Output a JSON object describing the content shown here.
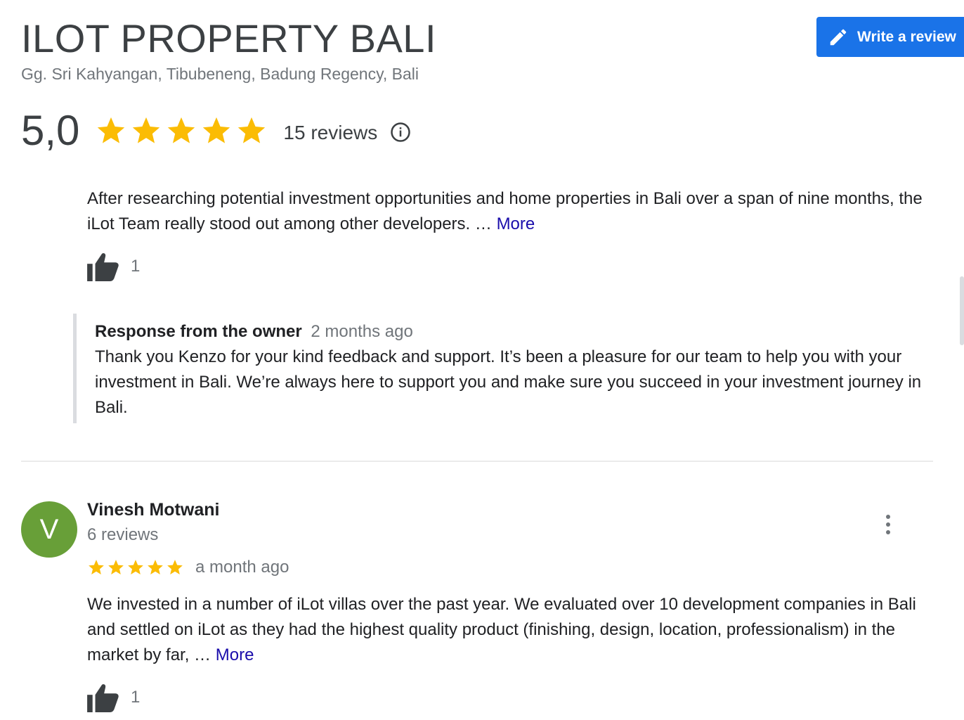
{
  "place": {
    "name": "ILOT PROPERTY BALI",
    "address": "Gg. Sri Kahyangan, Tibubeneng, Badung Regency, Bali"
  },
  "write_review_label": "Write a review",
  "summary": {
    "rating": "5,0",
    "stars": 5,
    "reviews_count_text": "15 reviews"
  },
  "review1": {
    "text": "After researching potential investment opportunities and home properties in Bali over a span of nine months, the iLot Team really stood out among other developers. …",
    "more_label": "More",
    "likes": "1",
    "owner_response": {
      "label": "Response from the owner",
      "time": "2 months ago",
      "text": "Thank you Kenzo for your kind feedback and support. It’s been a pleasure for our team to help you with your investment in Bali. We’re always here to support you and make sure you succeed in your investment journey in Bali."
    }
  },
  "review2": {
    "avatar_letter": "V",
    "name": "Vinesh Motwani",
    "reviews_text": "6 reviews",
    "stars": 5,
    "time": "a month ago",
    "text": "We invested in a number of iLot villas over the past year. We evaluated over 10 development companies in Bali and settled on iLot as they had the highest quality product (finishing, design, location, professionalism) in the market by far, …",
    "more_label": "More",
    "likes": "1"
  },
  "colors": {
    "star": "#fbbc04",
    "accent_button": "#1a73e8",
    "link": "#1a0dab",
    "avatar": "#689f38"
  },
  "icons": {
    "write_review": "pencil-icon",
    "info": "info-icon",
    "like": "thumbs-up-icon",
    "menu": "more-vert-icon"
  }
}
